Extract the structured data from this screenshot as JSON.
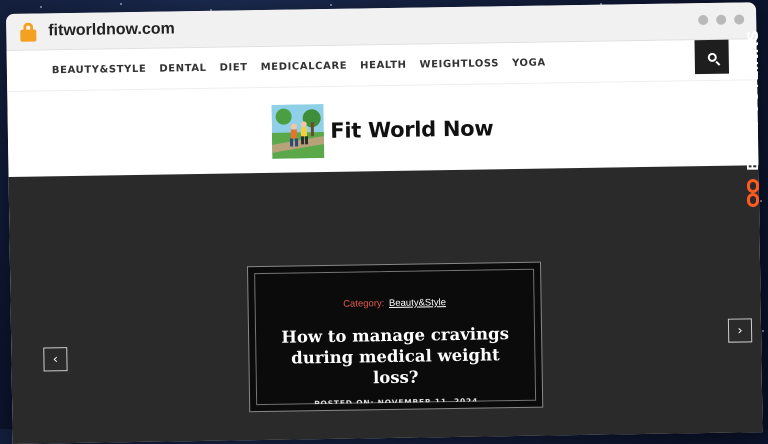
{
  "browser": {
    "url": "fitworldnow.com"
  },
  "nav": {
    "items": [
      "BEAUTY&STYLE",
      "DENTAL",
      "DIET",
      "MEDICALCARE",
      "HEALTH",
      "WEIGHTLOSS",
      "YOGA"
    ]
  },
  "site": {
    "name": "Fit World Now"
  },
  "hero": {
    "category_label": "Category:",
    "category_value": "Beauty&Style",
    "headline": "How to manage cravings during medical weight loss?",
    "posted": "POSTED ON: NOVEMBER 11, 2024",
    "prev_icon": "chevron-left-icon",
    "next_icon": "chevron-right-icon"
  },
  "brand_side": {
    "text": "BESTPOSTLINKS",
    "accent": "#ff5a1f"
  },
  "colors": {
    "hero_bg": "#2a2a2a",
    "category_label": "#e45a4a",
    "lock": "#f4a020"
  }
}
